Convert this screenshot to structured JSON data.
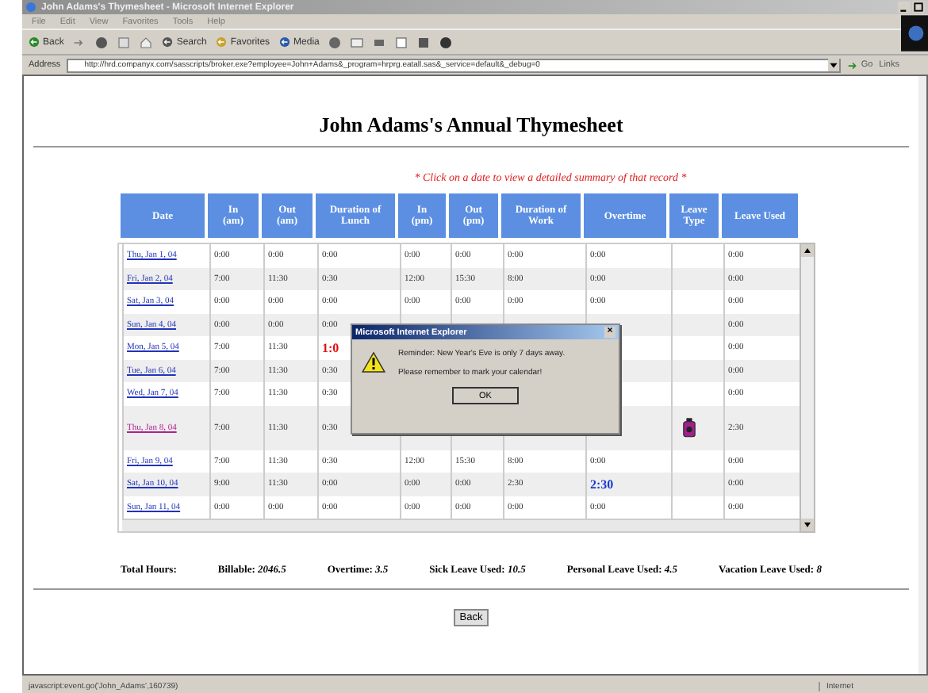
{
  "window": {
    "title": "John Adams's Thymesheet - Microsoft Internet Explorer"
  },
  "menu": [
    "File",
    "Edit",
    "View",
    "Favorites",
    "Tools",
    "Help"
  ],
  "toolbar": [
    {
      "label": "Back"
    },
    {
      "label": "Search"
    },
    {
      "label": "Favorites"
    },
    {
      "label": "Media"
    }
  ],
  "address": {
    "label": "Address",
    "value": "http://hrd.companyx.com/sasscripts/broker.exe?employee=John+Adams&_program=hrprg.eatall.sas&_service=default&_debug=0",
    "go": "Go",
    "links": "Links"
  },
  "page": {
    "title": "John Adams's Annual Thymesheet",
    "note": "* Click on a date to view a detailed summary of that record *"
  },
  "table": {
    "columns": [
      "Date",
      "In (am)",
      "Out (am)",
      "Duration of Lunch",
      "In (pm)",
      "Out (pm)",
      "Duration of Work",
      "Overtime",
      "Leave Type",
      "Leave Used"
    ],
    "rows": [
      {
        "cells": [
          {
            "kind": "date",
            "text": "Thu, Jan 1, 04",
            "visited": false
          },
          "0:00",
          "0:00",
          "0:00",
          "0:00",
          "0:00",
          "0:00",
          "0:00",
          null,
          "0:00"
        ]
      },
      {
        "cells": [
          {
            "kind": "date",
            "text": "Fri, Jan 2, 04",
            "visited": false
          },
          "7:00",
          "11:30",
          "0:30",
          "12:00",
          "15:30",
          "8:00",
          "0:00",
          null,
          "0:00"
        ]
      },
      {
        "cells": [
          {
            "kind": "date",
            "text": "Sat, Jan 3, 04",
            "visited": false
          },
          "0:00",
          "0:00",
          "0:00",
          "0:00",
          "0:00",
          "0:00",
          "0:00",
          null,
          "0:00"
        ]
      },
      {
        "cells": [
          {
            "kind": "date",
            "text": "Sun, Jan 4, 04",
            "visited": false
          },
          "0:00",
          "0:00",
          "0:00",
          null,
          null,
          null,
          null,
          null,
          "0:00"
        ]
      },
      {
        "cells": [
          {
            "kind": "date",
            "text": "Mon, Jan 5, 04",
            "visited": false
          },
          "7:00",
          "11:30",
          {
            "text": "1:0",
            "kind": "late"
          },
          null,
          null,
          null,
          null,
          null,
          "0:00"
        ]
      },
      {
        "cells": [
          {
            "kind": "date",
            "text": "Tue, Jan 6, 04",
            "visited": false
          },
          "7:00",
          "11:30",
          "0:30",
          null,
          null,
          null,
          null,
          null,
          "0:00"
        ]
      },
      {
        "cells": [
          {
            "kind": "date",
            "text": "Wed, Jan 7, 04",
            "visited": false
          },
          "7:00",
          "11:30",
          "0:30",
          null,
          null,
          null,
          null,
          null,
          "0:00"
        ]
      },
      {
        "cells": [
          {
            "kind": "date",
            "text": "Thu, Jan 8, 04",
            "visited": true
          },
          "7:00",
          "11:30",
          "0:30",
          null,
          null,
          null,
          null,
          {
            "kind": "leave-icon"
          },
          "2:30"
        ]
      },
      {
        "cells": [
          {
            "kind": "date",
            "text": "Fri, Jan 9, 04",
            "visited": false
          },
          "7:00",
          "11:30",
          "0:30",
          "12:00",
          "15:30",
          "8:00",
          "0:00",
          null,
          "0:00"
        ]
      },
      {
        "cells": [
          {
            "kind": "date",
            "text": "Sat, Jan 10, 04",
            "visited": false
          },
          "9:00",
          "11:30",
          "0:00",
          "0:00",
          "0:00",
          "2:30",
          {
            "text": "2:30",
            "kind": "overtime"
          },
          null,
          "0:00"
        ]
      },
      {
        "cells": [
          {
            "kind": "date",
            "text": "Sun, Jan 11, 04",
            "visited": false
          },
          "0:00",
          "0:00",
          "0:00",
          "0:00",
          "0:00",
          "0:00",
          "0:00",
          null,
          "0:00"
        ]
      }
    ]
  },
  "totals": {
    "label": "Total Hours:",
    "items": [
      "Billable: *2046.5*",
      "Overtime: *3.5*",
      "Sick Leave Used: *10.5*",
      "Personal Leave Used: *4.5*",
      "Vacation Leave Used: *8*"
    ]
  },
  "back_button": "Back",
  "dialog": {
    "title": "Microsoft Internet Explorer",
    "close": "×",
    "lines": [
      "Reminder: New Year's Eve is only 7 days away.",
      "Please remember to mark your calendar!"
    ],
    "button": "OK"
  },
  "status_bar": {
    "text": "javascript:event.go('John_Adams',160739)",
    "zone": "Internet"
  }
}
